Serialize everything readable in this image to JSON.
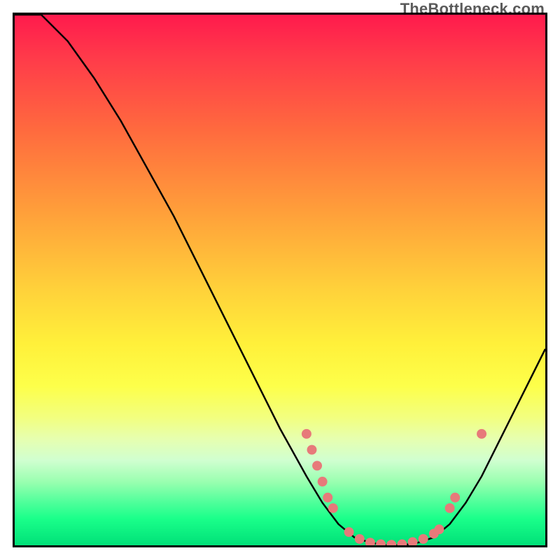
{
  "attribution": "TheBottleneck.com",
  "chart_data": {
    "type": "line",
    "title": "",
    "xlabel": "",
    "ylabel": "",
    "xlim": [
      0,
      100
    ],
    "ylim": [
      0,
      100
    ],
    "grid": false,
    "curve": [
      {
        "x": 0,
        "y": 100
      },
      {
        "x": 5,
        "y": 100
      },
      {
        "x": 10,
        "y": 95
      },
      {
        "x": 15,
        "y": 88
      },
      {
        "x": 20,
        "y": 80
      },
      {
        "x": 25,
        "y": 71
      },
      {
        "x": 30,
        "y": 62
      },
      {
        "x": 35,
        "y": 52
      },
      {
        "x": 40,
        "y": 42
      },
      {
        "x": 45,
        "y": 32
      },
      {
        "x": 50,
        "y": 22
      },
      {
        "x": 55,
        "y": 13
      },
      {
        "x": 58,
        "y": 8
      },
      {
        "x": 61,
        "y": 4
      },
      {
        "x": 64,
        "y": 1.5
      },
      {
        "x": 67,
        "y": 0.5
      },
      {
        "x": 70,
        "y": 0
      },
      {
        "x": 73,
        "y": 0
      },
      {
        "x": 76,
        "y": 0.5
      },
      {
        "x": 79,
        "y": 1.5
      },
      {
        "x": 82,
        "y": 4
      },
      {
        "x": 85,
        "y": 8
      },
      {
        "x": 88,
        "y": 13
      },
      {
        "x": 91,
        "y": 19
      },
      {
        "x": 94,
        "y": 25
      },
      {
        "x": 97,
        "y": 31
      },
      {
        "x": 100,
        "y": 37
      }
    ],
    "markers": [
      {
        "x": 55,
        "y": 21
      },
      {
        "x": 56,
        "y": 18
      },
      {
        "x": 57,
        "y": 15
      },
      {
        "x": 58,
        "y": 12
      },
      {
        "x": 59,
        "y": 9
      },
      {
        "x": 60,
        "y": 7
      },
      {
        "x": 63,
        "y": 2.5
      },
      {
        "x": 65,
        "y": 1.2
      },
      {
        "x": 67,
        "y": 0.5
      },
      {
        "x": 69,
        "y": 0.2
      },
      {
        "x": 71,
        "y": 0.1
      },
      {
        "x": 73,
        "y": 0.2
      },
      {
        "x": 75,
        "y": 0.6
      },
      {
        "x": 77,
        "y": 1.2
      },
      {
        "x": 79,
        "y": 2.2
      },
      {
        "x": 80,
        "y": 3
      },
      {
        "x": 82,
        "y": 7
      },
      {
        "x": 83,
        "y": 9
      },
      {
        "x": 88,
        "y": 21
      }
    ],
    "marker_color": "#e77a7a",
    "curve_color": "#000000"
  }
}
